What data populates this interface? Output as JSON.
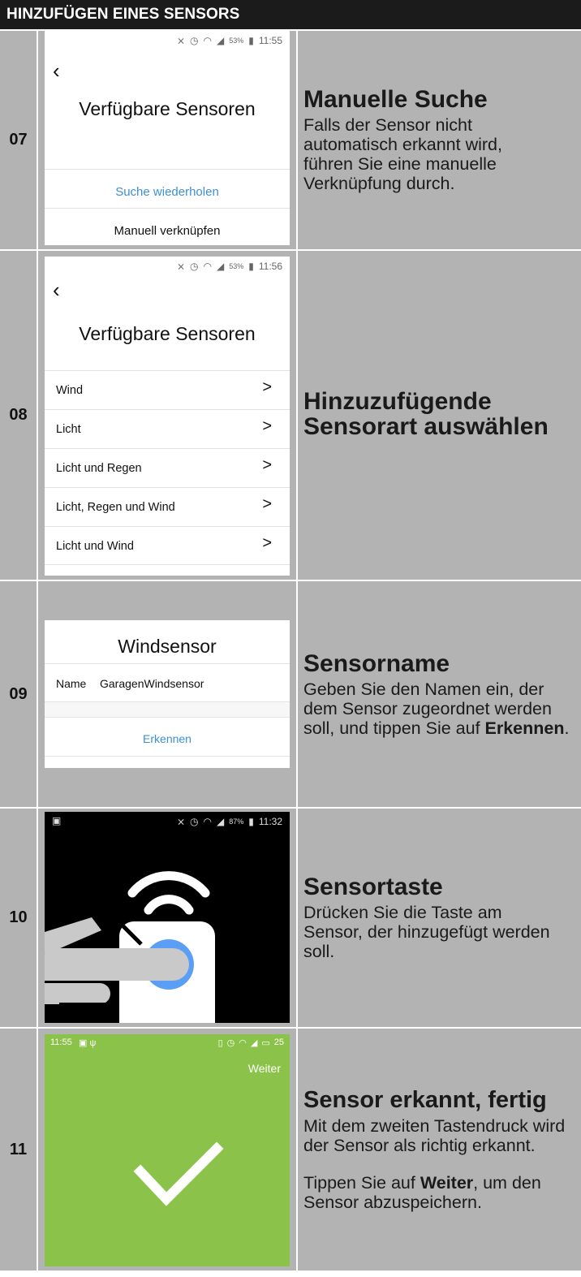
{
  "header": {
    "title": "HINZUFÜGEN EINES SENSORS"
  },
  "steps": [
    {
      "number": "07",
      "heading": "Manuelle Suche",
      "text": "Falls der Sensor nicht automatisch erkannt wird, führen Sie eine manuelle Verknüpfung durch.",
      "screen": {
        "time": "11:55",
        "battery": "53%",
        "title": "Verfügbare Sensoren",
        "retry_button": "Suche wiederholen",
        "manual_button": "Manuell verknüpfen"
      }
    },
    {
      "number": "08",
      "heading_line1": "Hinzuzufügende",
      "heading_line2": "Sensorart auswählen",
      "screen": {
        "time": "11:56",
        "battery": "53%",
        "title": "Verfügbare Sensoren",
        "items": [
          "Wind",
          "Licht",
          "Licht und Regen",
          "Licht, Regen und Wind",
          "Licht und Wind"
        ]
      }
    },
    {
      "number": "09",
      "heading": "Sensorname",
      "text_before": "Geben Sie den Namen ein, der dem Sensor zugeordnet werden soll, und tippen Sie auf ",
      "text_bold": "Erkennen",
      "text_after": ".",
      "screen": {
        "title": "Windsensor",
        "name_label": "Name",
        "name_value": "GaragenWindsensor",
        "detect_button": "Erkennen"
      }
    },
    {
      "number": "10",
      "heading": "Sensortaste",
      "text": "Drücken Sie die Taste am Sensor, der hinzugefügt werden soll.",
      "screen": {
        "time": "11:32",
        "battery": "87%"
      }
    },
    {
      "number": "11",
      "heading": "Sensor erkannt, fertig",
      "text": "Mit dem zweiten Tastendruck wird der Sensor als richtig erkannt.",
      "text2_before": "Tippen Sie auf ",
      "text2_bold": "Weiter",
      "text2_after": ", um den Sensor abzuspeichern.",
      "screen": {
        "time": "11:55",
        "battery": "25",
        "next_button": "Weiter"
      }
    }
  ],
  "colors": {
    "header_bg": "#1b1b1b",
    "row_bg": "#b3b3b3",
    "link_blue": "#3d8fd6",
    "success_green": "#8bc34a",
    "button_blue": "#5a9ef5"
  }
}
